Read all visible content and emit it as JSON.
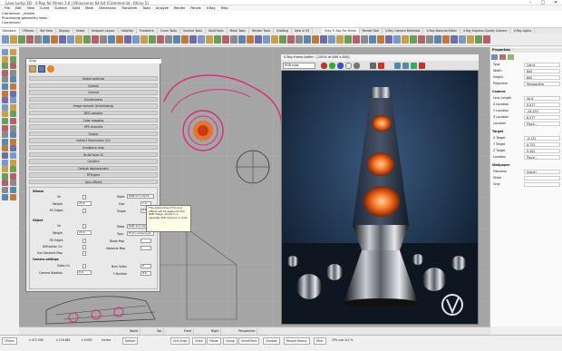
{
  "window": {
    "title": "Lava Lamp 3D - V-Ray for Rhino 3.6 | Rhinoceros 64-bit (Commercial - Rhino 5)",
    "min": "–",
    "max": "□",
    "close": "✕"
  },
  "menu": [
    "File",
    "Edit",
    "View",
    "Curve",
    "Surface",
    "Solid",
    "Mesh",
    "Dimension",
    "Transform",
    "Tools",
    "Analyze",
    "Render",
    "Panels",
    "V-Ray",
    "Help"
  ],
  "command_history": [
    "Command: _render",
    "Processing geometry data",
    "Command:"
  ],
  "toolbar_tabs": [
    "Standard",
    "CPlanes",
    "Set View",
    "Display",
    "Select",
    "Viewport Layout",
    "Visibility",
    "Transform",
    "Curve Tools",
    "Surface Tools",
    "Solid Tools",
    "Mesh Tools",
    "Render Tools",
    "Drafting",
    "New in V5"
  ],
  "toolbar_tabs_right": [
    "Vray 3: Ray For Rhino",
    "Render Tool",
    "V-Ray Camera Materials",
    "V-Ray Material Editor",
    "V-Ray Express Quality Camera",
    "V-Ray Lights"
  ],
  "viewport_tabs": {
    "perspective": "Perspective",
    "top": "Top",
    "front": "Front",
    "right": "Right"
  },
  "vray_options": {
    "title": "Vray",
    "rollouts": [
      "Global switches",
      "System",
      "Camera",
      "Environment",
      "Image sampler (Antialiasing)",
      "DMC sampler",
      "Color mapping",
      "VFB channels",
      "Output",
      "Indirect illumination (GI)",
      "Irradiance map",
      "Brute force GI",
      "Caustics",
      "Default displacement",
      "RTEngine",
      "Lens effects"
    ],
    "gi": {
      "section1": "Gfanse",
      "on_label": "On",
      "weight_label": "Weight",
      "weight_val": "20.0",
      "filledges_label": "Fill Edges",
      "mode_label": "Mode",
      "mode_val": "RGB and Alpha",
      "size_label": "Size",
      "size_val": "1.0",
      "shape_label": "Shape",
      "shape_val": "0.5",
      "section2": "Object",
      "on2_label": "On",
      "weight2_label": "Weight",
      "weight2_val": "20.0",
      "filledges2_label": "Fill Edges",
      "diffraction_label": "Diffraction On",
      "obstacle_label": "Use Obstacle Map",
      "mode2_label": "Mode",
      "mode2_val": "RGB and Alpha",
      "type_label": "Type",
      "type_val": "From camera pa",
      "blade_label": "Blade Map",
      "obstmap_label": "Obstacle Map",
      "camsettings_label": "Camera settings",
      "sides_label": "Sides On",
      "sides_val": "6",
      "numsides_label": "Num Sides",
      "numsides_val": "6",
      "rotation_label": "Camera Rotation",
      "rotation_val": "0.0",
      "fnumber_label": "F-Number",
      "fnumber_val": "8.0"
    },
    "tooltip": "This determines if the lens effects will be applied to the RGB image, stored in a separate VFB channel, or both"
  },
  "frame_buffer": {
    "title": "V-Ray frame buffer - [100% of 800 x 600]",
    "channel": "RGB color"
  },
  "properties": {
    "title": "Properties",
    "rows": [
      {
        "k": "Type",
        "v": "Cam1"
      },
      {
        "k": "Width",
        "v": "800"
      },
      {
        "k": "Height",
        "v": "600"
      },
      {
        "k": "Projection",
        "v": "Perspective"
      }
    ],
    "camera_head": "Camera",
    "camera_rows": [
      {
        "k": "Lens Length",
        "v": "50.0"
      },
      {
        "k": "X Location",
        "v": "0.017"
      },
      {
        "k": "Y Location",
        "v": "-34.233"
      },
      {
        "k": "Z Location",
        "v": "8.577"
      },
      {
        "k": "Location",
        "v": "Place..."
      }
    ],
    "target_head": "Target",
    "target_rows": [
      {
        "k": "X Target",
        "v": "-0.131"
      },
      {
        "k": "Y Target",
        "v": "0.722"
      },
      {
        "k": "Z Target",
        "v": "9.302"
      },
      {
        "k": "Location",
        "v": "Place..."
      }
    ],
    "wallpaper_head": "Wallpaper",
    "wallpaper_rows": [
      {
        "k": "Filename",
        "v": "(none)"
      },
      {
        "k": "Show",
        "v": ""
      },
      {
        "k": "Gray",
        "v": ""
      }
    ]
  },
  "command_bar": [
    "World",
    "Top",
    "Front",
    "Right",
    "Perspective"
  ],
  "statusbar": {
    "cplane": "CPlane",
    "x": "x 472.538",
    "y": "y 116.881",
    "z": "z 0.000",
    "units": "Inches",
    "layer": "Default",
    "gridsnap": "Grid Snap",
    "ortho": "Ortho",
    "planar": "Planar",
    "osnap": "Osnap",
    "smarttrack": "SmartTrack",
    "gumball": "Gumball",
    "record": "Record History",
    "filter": "Filter",
    "cpu": "CPU use: 8.2 %"
  },
  "colors": {
    "accent": "#d6307a",
    "panel": "#d3d3d3",
    "orange": "#f26a1b"
  }
}
